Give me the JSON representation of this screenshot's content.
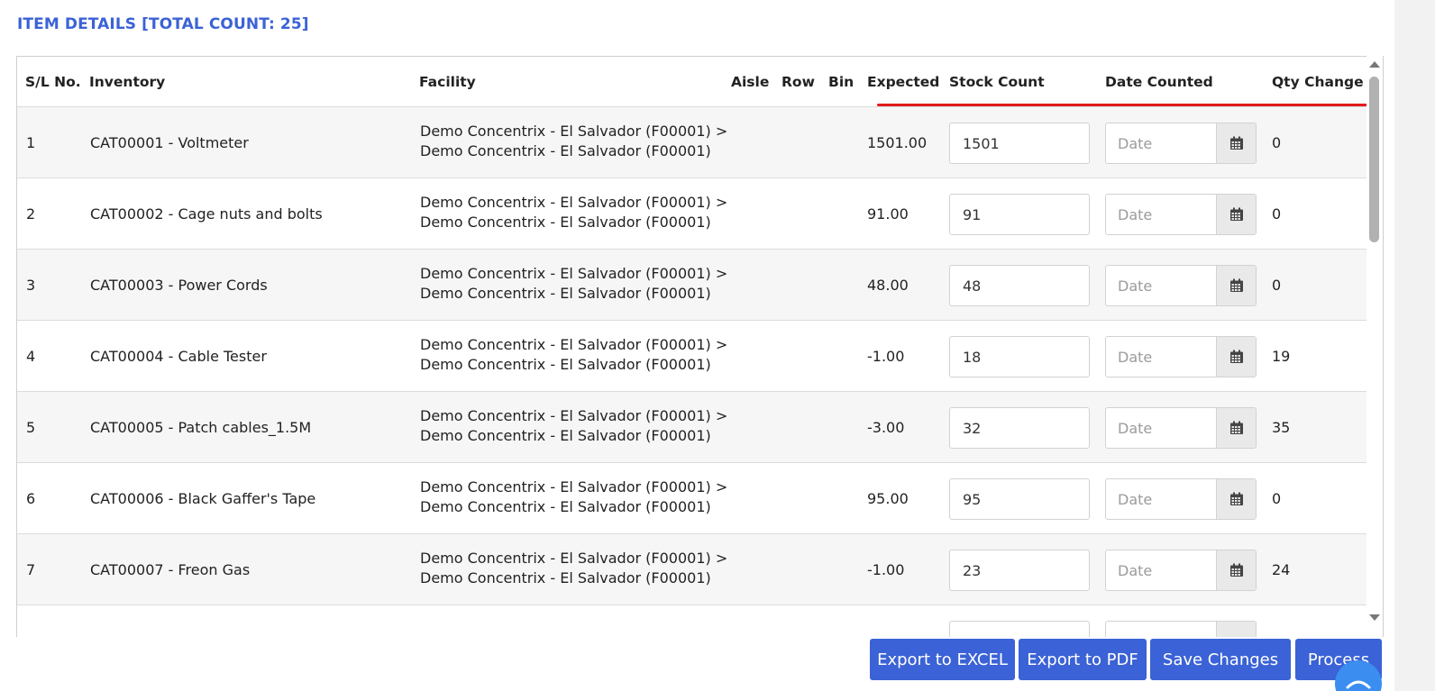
{
  "section": {
    "title": "ITEM DETAILS [TOTAL COUNT: 25]"
  },
  "columns": {
    "sl": "S/L No.",
    "inventory": "Inventory",
    "facility": "Facility",
    "aisle": "Aisle",
    "row": "Row",
    "bin": "Bin",
    "expected": "Expected",
    "stock_count": "Stock Count",
    "date_counted": "Date Counted",
    "qty_change": "Qty Change"
  },
  "date_placeholder": "Date",
  "rows": [
    {
      "sl": "1",
      "inventory": "CAT00001 - Voltmeter",
      "facility_line1": "Demo Concentrix - El Salvador (F00001) >",
      "facility_line2": "Demo Concentrix - El Salvador (F00001)",
      "expected": "1501.00",
      "stock_count": "1501",
      "qty_change": "0"
    },
    {
      "sl": "2",
      "inventory": "CAT00002 - Cage nuts and bolts",
      "facility_line1": "Demo Concentrix - El Salvador (F00001) >",
      "facility_line2": "Demo Concentrix - El Salvador (F00001)",
      "expected": "91.00",
      "stock_count": "91",
      "qty_change": "0"
    },
    {
      "sl": "3",
      "inventory": "CAT00003 - Power Cords",
      "facility_line1": "Demo Concentrix - El Salvador (F00001) >",
      "facility_line2": "Demo Concentrix - El Salvador (F00001)",
      "expected": "48.00",
      "stock_count": "48",
      "qty_change": "0"
    },
    {
      "sl": "4",
      "inventory": "CAT00004 - Cable Tester",
      "facility_line1": "Demo Concentrix - El Salvador (F00001) >",
      "facility_line2": "Demo Concentrix - El Salvador (F00001)",
      "expected": "-1.00",
      "stock_count": "18",
      "qty_change": "19"
    },
    {
      "sl": "5",
      "inventory": "CAT00005 - Patch cables_1.5M",
      "facility_line1": "Demo Concentrix - El Salvador (F00001) >",
      "facility_line2": "Demo Concentrix - El Salvador (F00001)",
      "expected": "-3.00",
      "stock_count": "32",
      "qty_change": "35"
    },
    {
      "sl": "6",
      "inventory": "CAT00006 - Black Gaffer's Tape",
      "facility_line1": "Demo Concentrix - El Salvador (F00001) >",
      "facility_line2": "Demo Concentrix - El Salvador (F00001)",
      "expected": "95.00",
      "stock_count": "95",
      "qty_change": "0"
    },
    {
      "sl": "7",
      "inventory": "CAT00007 - Freon Gas",
      "facility_line1": "Demo Concentrix - El Salvador (F00001) >",
      "facility_line2": "Demo Concentrix - El Salvador (F00001)",
      "expected": "-1.00",
      "stock_count": "23",
      "qty_change": "24"
    },
    {
      "sl": "",
      "inventory": "",
      "facility_line1": "",
      "facility_line2": "",
      "expected": "",
      "stock_count": "",
      "qty_change": ""
    }
  ],
  "buttons": {
    "export_excel": "Export to EXCEL",
    "export_pdf": "Export to PDF",
    "save_changes": "Save Changes",
    "process": "Process"
  },
  "icons": {
    "date_picker": "calendar-icon",
    "chat": "chat-icon"
  },
  "colors": {
    "accent": "#3b62d6",
    "highlight_underline": "#e21b1b",
    "chat": "#3b8ef0"
  }
}
